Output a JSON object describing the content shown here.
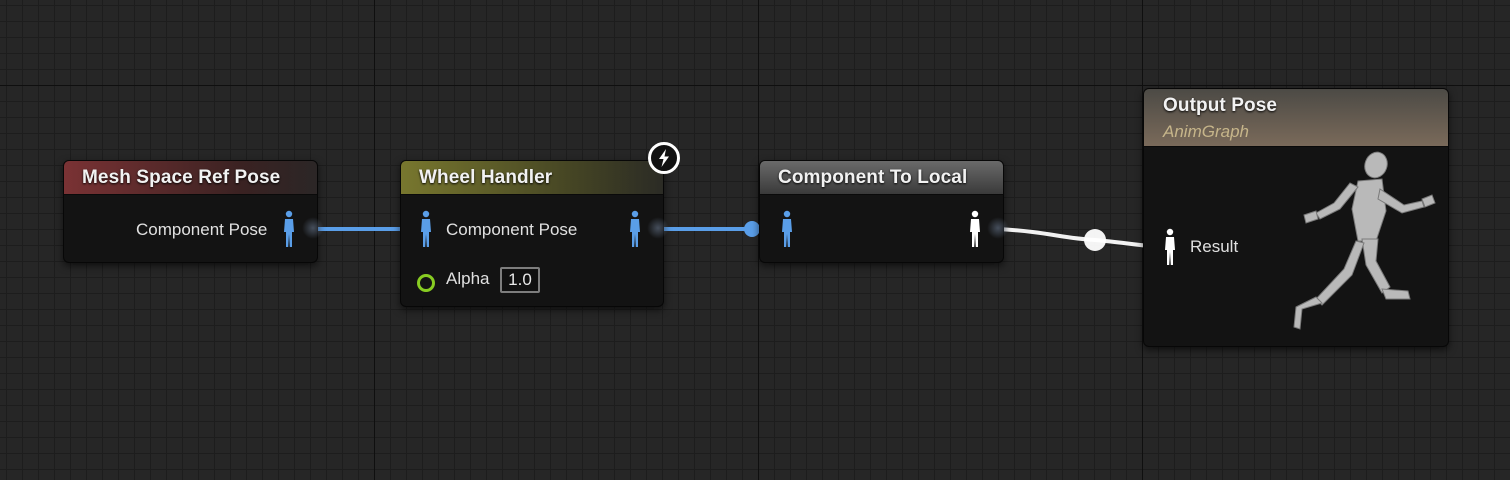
{
  "graph": {
    "nodes": {
      "mesh_space_ref_pose": {
        "title": "Mesh Space Ref Pose",
        "output_label": "Component Pose",
        "header_color": "#6b2a2c"
      },
      "wheel_handler": {
        "title": "Wheel Handler",
        "input_label": "Component Pose",
        "alpha_label": "Alpha",
        "alpha_value": "1.0",
        "header_color": "#6b6a28",
        "badge_icon": "lightning-bolt-icon"
      },
      "component_to_local": {
        "title": "Component To Local",
        "header_color": "#555555"
      },
      "output_pose": {
        "title": "Output Pose",
        "subtitle": "AnimGraph",
        "input_label": "Result",
        "header_color": "#6e6256",
        "preview_icon": "running-mannequin-icon"
      }
    },
    "colors": {
      "component_pose_pin": "#5a9ee8",
      "local_pose_pin": "#ffffff",
      "float_pin": "#88cc22"
    }
  }
}
